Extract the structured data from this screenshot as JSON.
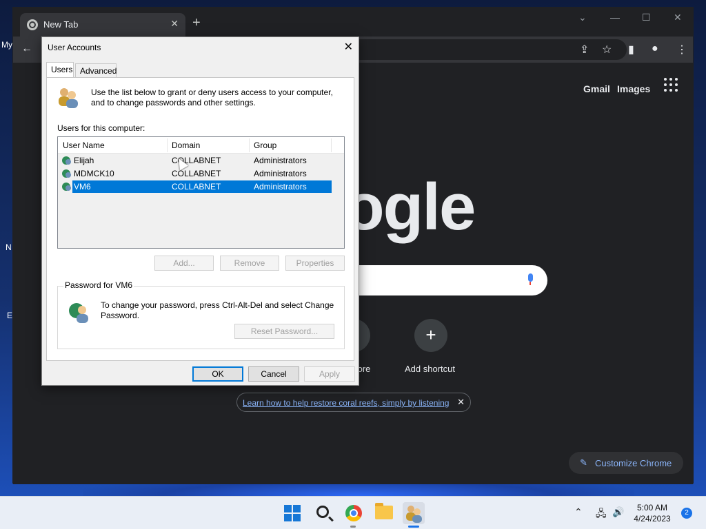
{
  "desktop": {
    "label_my": "My",
    "label_n": "N",
    "label_e": "E"
  },
  "chrome": {
    "tab_title": "New Tab",
    "top_links": [
      "Gmail",
      "Images"
    ],
    "google_text": "ogle",
    "shortcut_partial_label": "tore",
    "add_shortcut_label": "Add shortcut",
    "notification_link": "Learn how to help restore coral reefs, simply by listening",
    "customize_label": "Customize Chrome"
  },
  "dialog": {
    "title": "User Accounts",
    "tabs": [
      "Users",
      "Advanced"
    ],
    "intro": "Use the list below to grant or deny users access to your computer, and to change passwords and other settings.",
    "users_label": "Users for this computer:",
    "columns": [
      "User Name",
      "Domain",
      "Group"
    ],
    "rows": [
      {
        "name": "Elijah",
        "domain": "COLLABNET",
        "group": "Administrators"
      },
      {
        "name": "MDMCK10",
        "domain": "COLLABNET",
        "group": "Administrators"
      },
      {
        "name": "VM6",
        "domain": "COLLABNET",
        "group": "Administrators"
      }
    ],
    "selected_row": 2,
    "list_buttons": [
      "Add...",
      "Remove",
      "Properties"
    ],
    "password_group_title": "Password for VM6",
    "password_text": "To change your password, press Ctrl-Alt-Del and select Change Password.",
    "reset_password_button": "Reset Password...",
    "ok": "OK",
    "cancel": "Cancel",
    "apply": "Apply"
  },
  "taskbar": {
    "time": "5:00 AM",
    "date": "4/24/2023",
    "notification_count": "2"
  }
}
